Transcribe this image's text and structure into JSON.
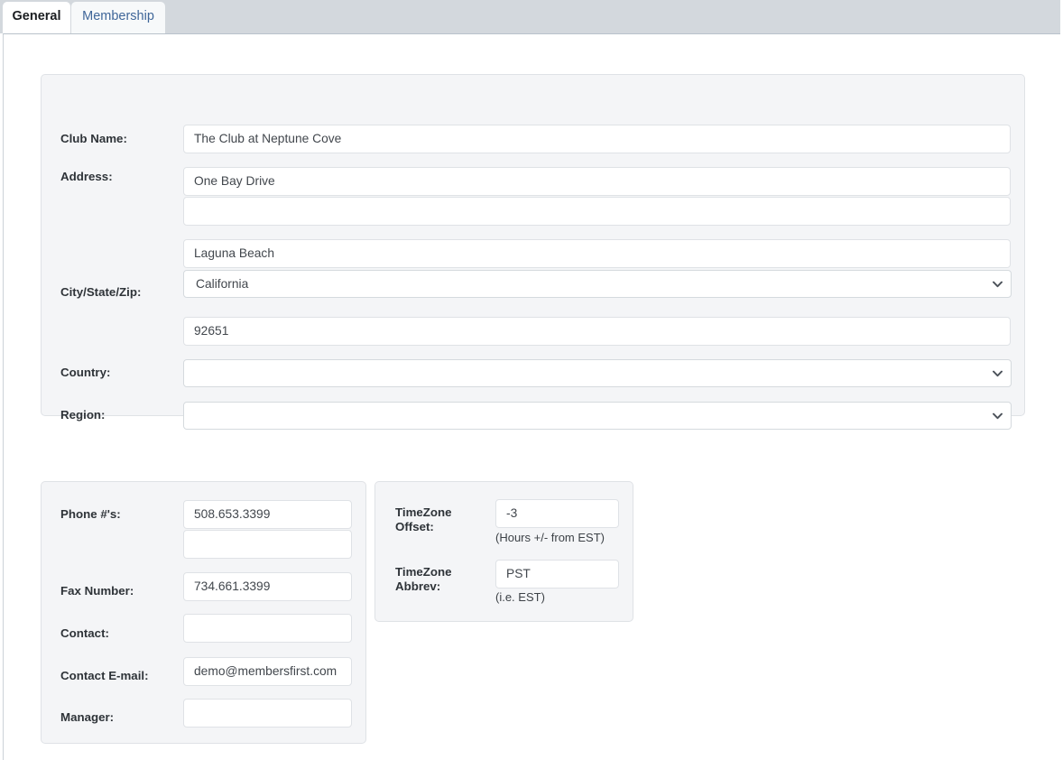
{
  "tabs": [
    {
      "label": "General",
      "active": true
    },
    {
      "label": "Membership",
      "active": false
    }
  ],
  "colors": {
    "tabbar_bg": "#d3d8dd",
    "panel_bg": "#f4f5f7",
    "panel_border": "#dfe2e6",
    "inactive_tab_text": "#3f6699",
    "label_text": "#2e3338",
    "value_text": "#42474d"
  },
  "general_panel": {
    "labels": {
      "club_name": "Club Name:",
      "address": "Address:",
      "city_state_zip": "City/State/Zip:",
      "country": "Country:",
      "region": "Region:"
    },
    "fields": {
      "club_name": "The Club at Neptune Cove",
      "address_line1": "One Bay Drive",
      "address_line2": "",
      "city": "Laguna Beach",
      "state": "California",
      "zip": "92651",
      "country": "",
      "region": ""
    },
    "placeholders": {
      "club_name": "",
      "address_line1": "",
      "address_line2": "",
      "city": "",
      "zip": ""
    }
  },
  "contact_panel": {
    "labels": {
      "phone": "Phone #'s:",
      "fax": "Fax Number:",
      "contact": "Contact:",
      "contact_email": "Contact E-mail:",
      "manager": "Manager:"
    },
    "fields": {
      "phone1": "508.653.3399",
      "phone2": "",
      "fax": "734.661.3399",
      "contact": "",
      "contact_email": "demo@membersfirst.com",
      "manager": ""
    }
  },
  "timezone_panel": {
    "labels": {
      "offset": "TimeZone Offset:",
      "abbrev": "TimeZone Abbrev:"
    },
    "label_lines": {
      "offset_l1": "TimeZone",
      "offset_l2": "Offset:",
      "abbrev_l1": "TimeZone",
      "abbrev_l2": "Abbrev:"
    },
    "fields": {
      "offset": "-3",
      "abbrev": "PST"
    },
    "hints": {
      "offset": "(Hours +/- from EST)",
      "abbrev": "(i.e. EST)"
    }
  },
  "icons": {
    "chevron_down": "chevron-down-icon"
  }
}
